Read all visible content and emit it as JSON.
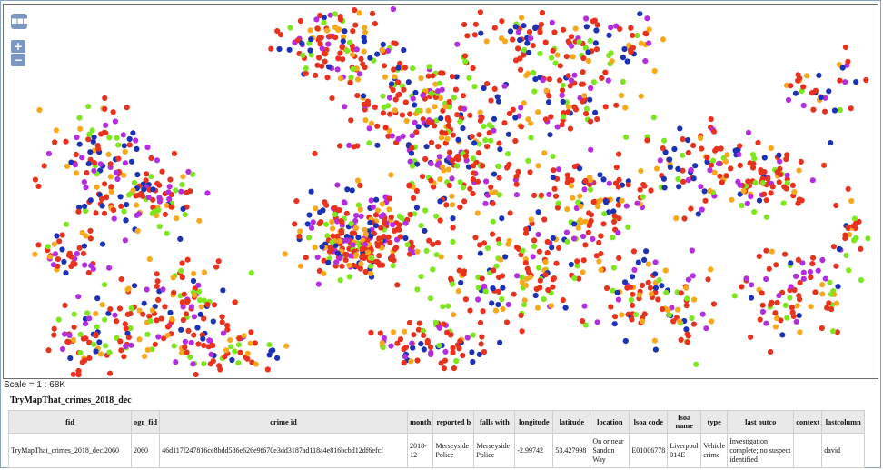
{
  "map": {
    "scale_label": "Scale = 1 : 68K",
    "controls": {
      "menu_glyph": "▪▪▪",
      "zoom_in": "+",
      "zoom_out": "−"
    },
    "point_colors": [
      "#e8321e",
      "#e8321e",
      "#e8321e",
      "#1c32b4",
      "#b42ee0",
      "#7de61e",
      "#f7a81b"
    ]
  },
  "table": {
    "layer_title": "TryMapThat_crimes_2018_dec",
    "headers": [
      "fid",
      "ogr_fid",
      "crime id",
      "month",
      "reported b",
      "falls with",
      "longitude",
      "latitude",
      "location",
      "lsoa code",
      "lsoa name",
      "type",
      "last outco",
      "context",
      "lastcolumn"
    ],
    "rows": [
      [
        "TryMapThat_crimes_2018_dec.2060",
        "2060",
        "46d117f247816ce8bdd586e626e9f670e3dd3187ad118a4e816bcbd12df6efcf",
        "2018-12",
        "Merseyside Police",
        "Merseyside Police",
        "-2.99742",
        "53.427998",
        "On or near Sandon Way",
        "E01006778",
        "Liverpool 014E",
        "Vehicle crime",
        "Investigation complete; no suspect identified",
        "",
        "david"
      ]
    ]
  }
}
